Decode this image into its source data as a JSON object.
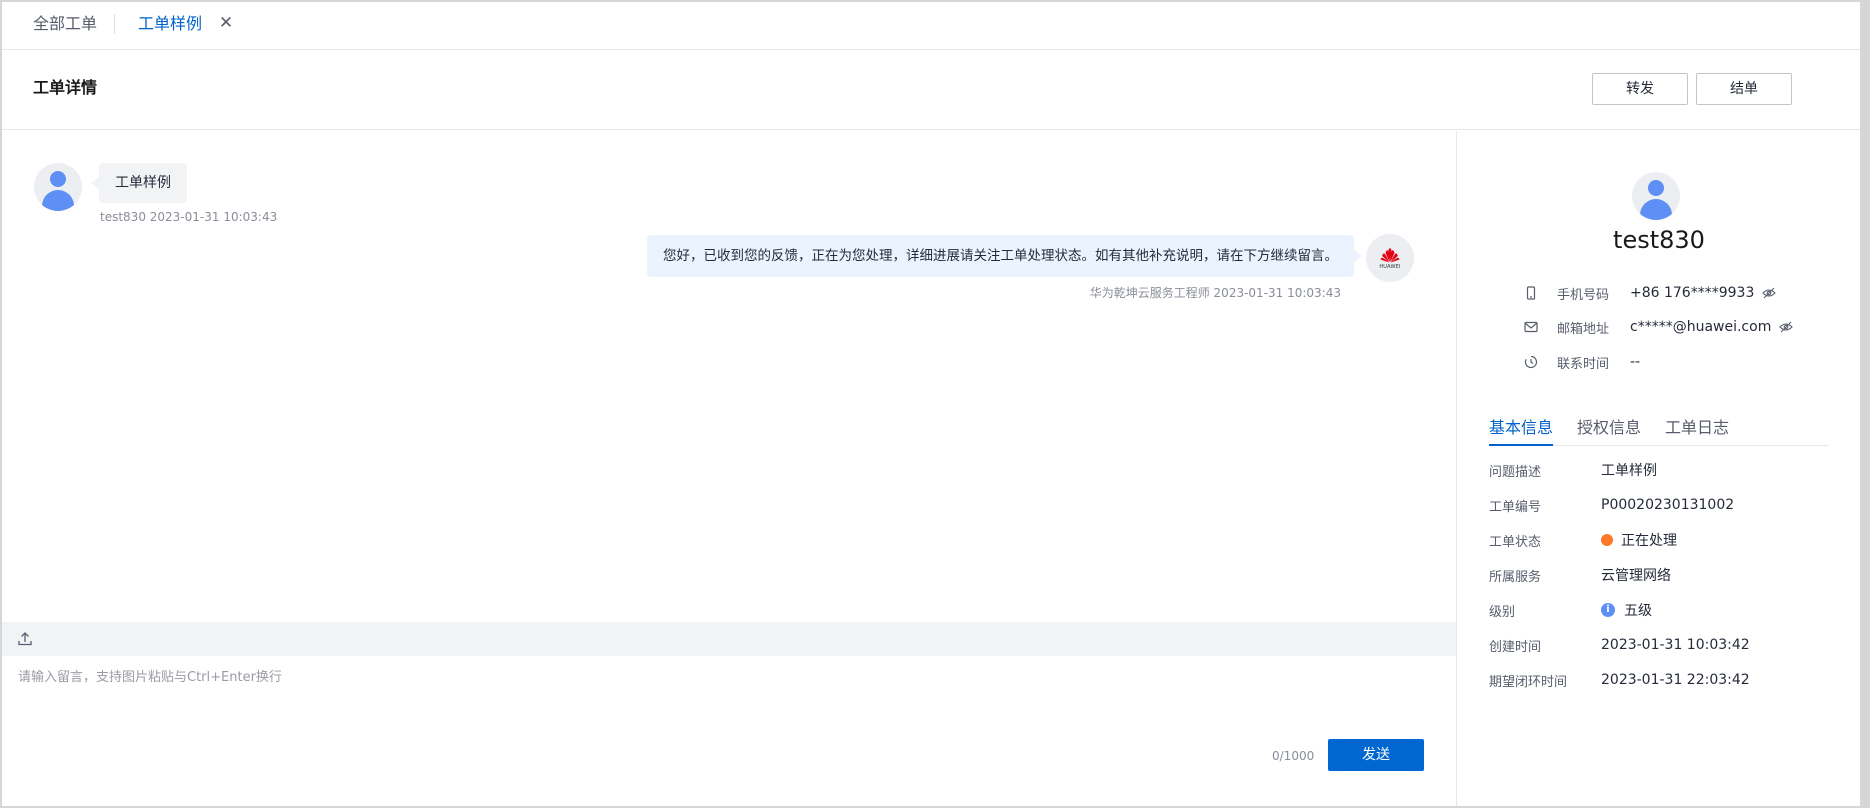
{
  "tabs": {
    "all_orders": "全部工单",
    "current": "工单样例",
    "close_icon": "close-icon"
  },
  "header": {
    "title": "工单详情",
    "forward_label": "转发",
    "close_order_label": "结单"
  },
  "chat": {
    "messages": [
      {
        "side": "left",
        "text": "工单样例",
        "meta": "test830 2023-01-31 10:03:43"
      },
      {
        "side": "right",
        "text": "您好，已收到您的反馈，正在为您处理，详细进展请关注工单处理状态。如有其他补充说明，请在下方继续留言。",
        "meta": "华为乾坤云服务工程师 2023-01-31 10:03:43",
        "avatar_text": "HUAWEI"
      }
    ]
  },
  "input": {
    "placeholder": "请输入留言，支持图片粘贴与Ctrl+Enter换行",
    "counter": "0/1000",
    "send_label": "发送"
  },
  "profile": {
    "name": "test830",
    "phone_label": "手机号码",
    "phone_value": "+86 176****9933",
    "email_label": "邮箱地址",
    "email_value": "c*****@huawei.com",
    "contact_time_label": "联系时间",
    "contact_time_value": "--"
  },
  "detail_tabs": [
    "基本信息",
    "授权信息",
    "工单日志"
  ],
  "basic_info": {
    "problem_label": "问题描述",
    "problem_value": "工单样例",
    "order_no_label": "工单编号",
    "order_no_value": "P00020230131002",
    "status_label": "工单状态",
    "status_value": "正在处理",
    "status_color": "#fa7827",
    "service_label": "所属服务",
    "service_value": "云管理网络",
    "level_label": "级别",
    "level_value": "五级",
    "created_label": "创建时间",
    "created_value": "2023-01-31 10:03:42",
    "expected_close_label": "期望闭环时间",
    "expected_close_value": "2023-01-31 22:03:42"
  },
  "colors": {
    "accent": "#0062cc",
    "primary_button": "#0067d1",
    "avatar": "#5e8ff5",
    "huawei_red": "#e60012"
  }
}
